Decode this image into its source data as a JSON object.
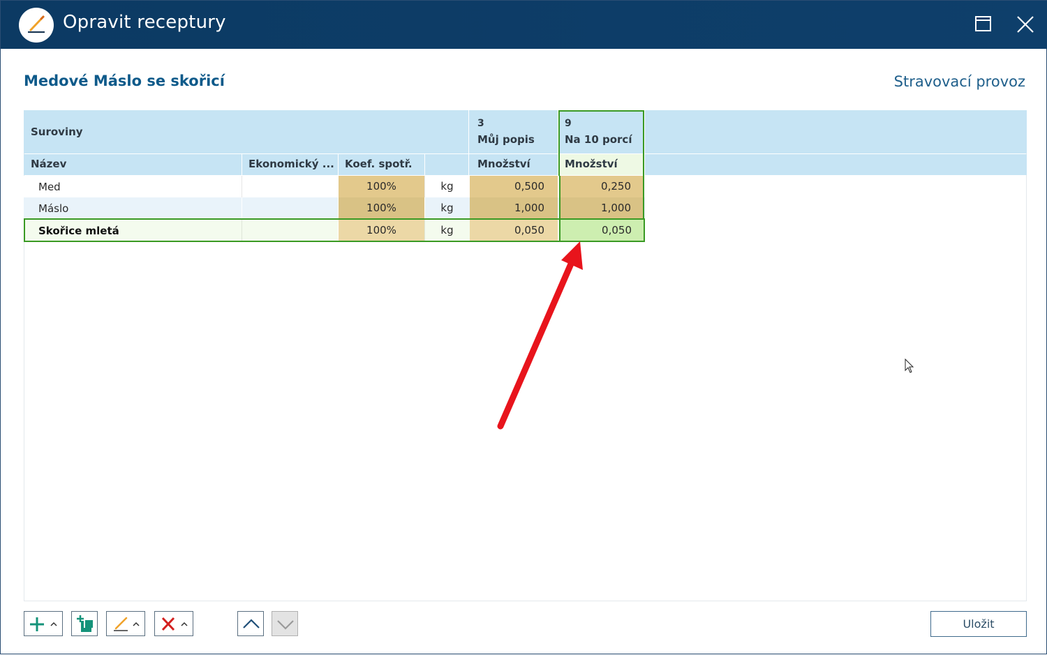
{
  "window": {
    "title": "Opravit receptury"
  },
  "header": {
    "recipe_name": "Medové Máslo se skořicí",
    "facility": "Stravovací provoz"
  },
  "table": {
    "group_header": "Suroviny",
    "columns": {
      "name": "Název",
      "economic": "Ekonomický ...",
      "coef": "Koef. spotř.",
      "unit": "",
      "qty1": "Množství",
      "qty2": "Množství"
    },
    "variants": [
      {
        "number": "3",
        "label": "Můj popis"
      },
      {
        "number": "9",
        "label": "Na 10 porcí"
      }
    ],
    "rows": [
      {
        "name": "Med",
        "economic": "",
        "coef": "100%",
        "unit": "kg",
        "qty1": "0,500",
        "qty2": "0,250"
      },
      {
        "name": "Máslo",
        "economic": "",
        "coef": "100%",
        "unit": "kg",
        "qty1": "1,000",
        "qty2": "1,000"
      },
      {
        "name": "Skořice mletá",
        "economic": "",
        "coef": "100%",
        "unit": "kg",
        "qty1": "0,050",
        "qty2": "0,050"
      }
    ]
  },
  "toolbar": {
    "add_icon": "plus-icon",
    "copy_icon": "copy-add-icon",
    "edit_icon": "pencil-icon",
    "delete_icon": "x-icon",
    "up_icon": "chevron-up-icon",
    "down_icon": "chevron-down-icon",
    "save_label": "Uložit"
  },
  "colors": {
    "titlebar": "#0e3f6b",
    "header_blue": "#c6e4f4",
    "tan": "#e3c98c",
    "tan_selected": "#ecd8a6",
    "green_selected": "#cdeeb0",
    "selection_border": "#3a9a24",
    "arrow_red": "#e8141c"
  }
}
